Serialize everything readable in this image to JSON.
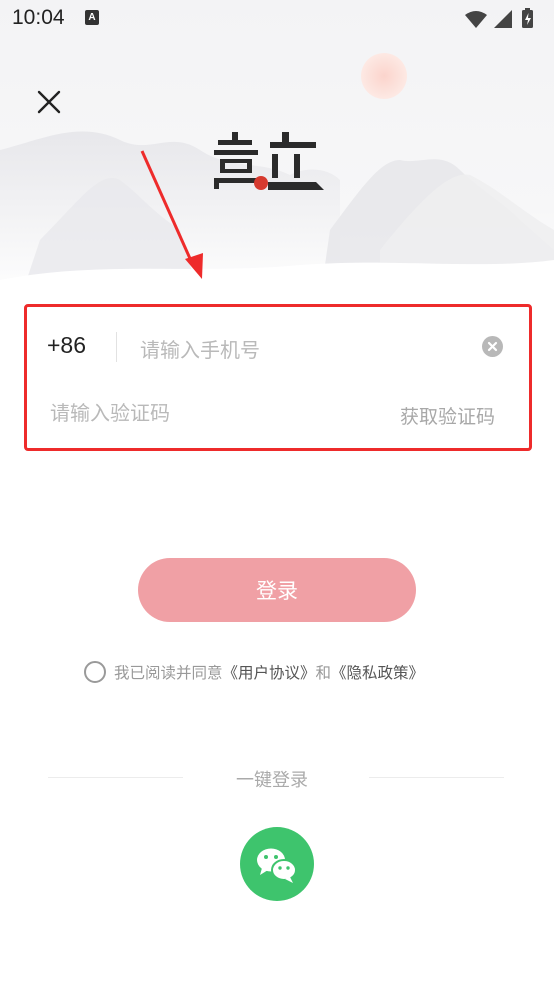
{
  "status_bar": {
    "time": "10:04",
    "notification_letter": "A",
    "icons": [
      "wifi-icon",
      "cell-signal-icon",
      "battery-charging-icon"
    ]
  },
  "header": {
    "close_icon": "close-icon",
    "logo_icon": "app-logo-icon"
  },
  "form": {
    "country_code": "+86",
    "phone": {
      "value": "",
      "placeholder": "请输入手机号"
    },
    "clear_icon": "clear-input-icon",
    "code": {
      "value": "",
      "placeholder": "请输入验证码"
    },
    "get_code_label": "获取验证码",
    "highlight_color": "#ee2b2b"
  },
  "login": {
    "label": "登录",
    "color": "#f0a0a5"
  },
  "agreement": {
    "checked": false,
    "prefix": "我已阅读并同意",
    "user_agreement": "《用户协议》",
    "conjunction": "和",
    "privacy_policy": "《隐私政策》"
  },
  "one_click": {
    "label": "一键登录",
    "wechat_icon": "wechat-icon",
    "wechat_color": "#3ec46d"
  }
}
